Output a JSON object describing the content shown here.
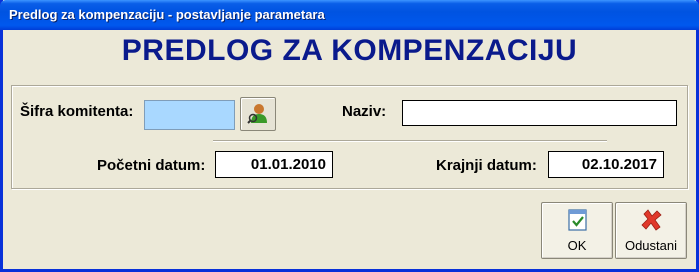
{
  "window": {
    "title": "Predlog za kompenzaciju - postavljanje parametara"
  },
  "heading": "PREDLOG ZA KOMPENZACIJU",
  "form": {
    "sifra_label": "Šifra komitenta:",
    "sifra_value": "",
    "naziv_label": "Naziv:",
    "naziv_value": "",
    "pocetni_label": "Početni datum:",
    "pocetni_value": "01.01.2010",
    "krajnji_label": "Krajnji datum:",
    "krajnji_value": "02.10.2017"
  },
  "buttons": {
    "ok_label": "OK",
    "cancel_label": "Odustani"
  },
  "icons": {
    "lookup": "user-lookup-icon",
    "ok": "checkmark-document-icon",
    "cancel": "red-x-icon"
  },
  "colors": {
    "titlebar": "#0053e1",
    "heading": "#0a1a8c",
    "sifra_field": "#a9d8ff",
    "background": "#ece9d8"
  }
}
